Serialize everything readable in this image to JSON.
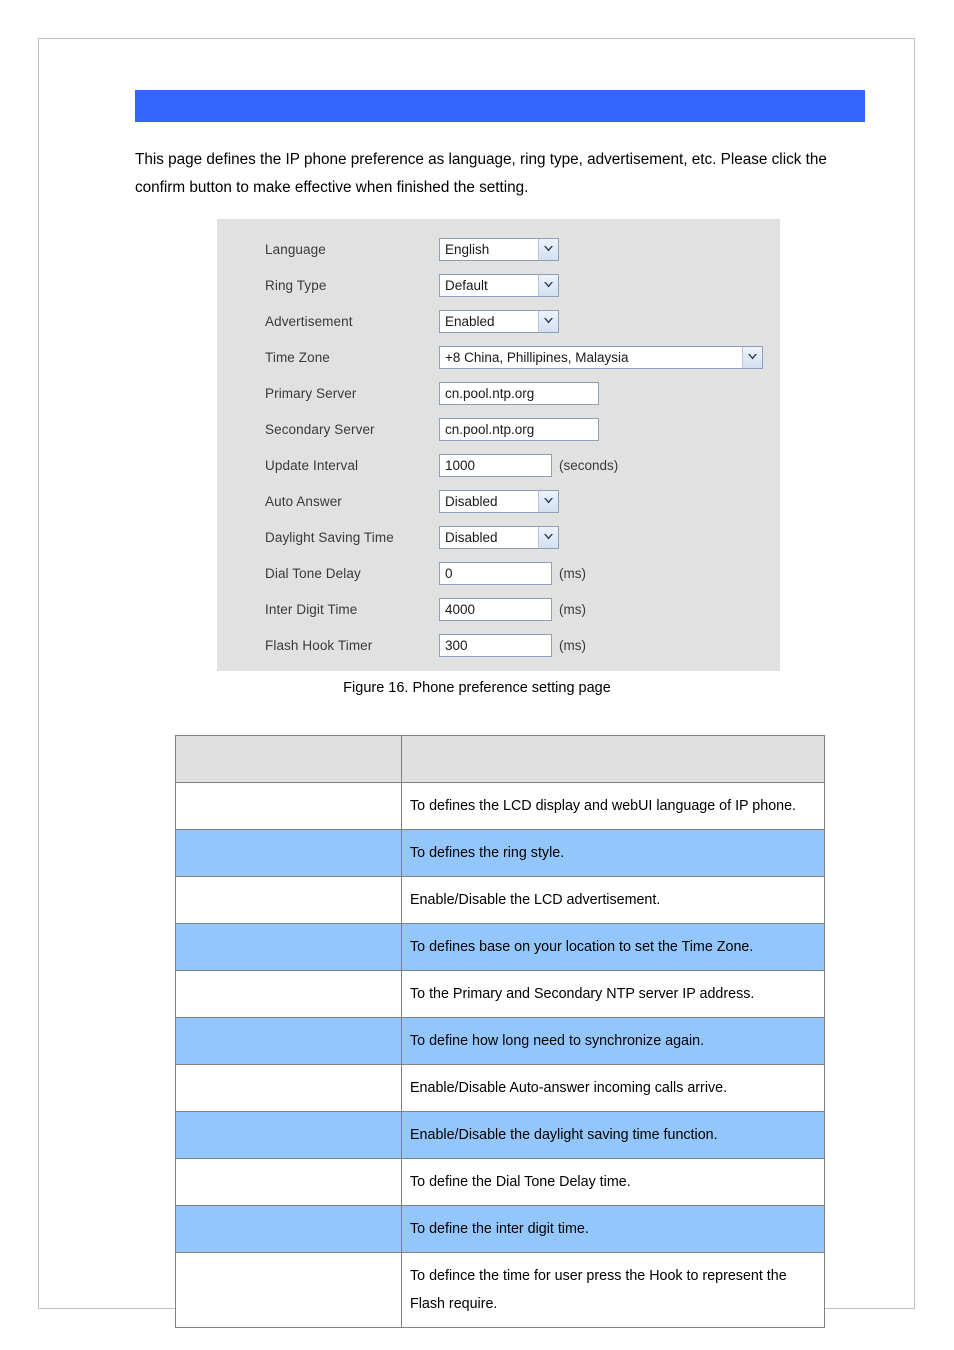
{
  "document": {
    "banner_title": "",
    "intro_paragraph": "This page defines the IP phone preference as language, ring type, advertisement, etc. Please click the confirm button to make effective when finished the setting.",
    "figure_caption": "Figure 16. Phone preference setting page"
  },
  "colors": {
    "banner_blue": "#3366ff",
    "table_row_blue": "#93c6fb",
    "table_header_gray": "#e0e0e0",
    "panel_gray": "#e1e1e1",
    "page_border": "#bfbfbf"
  },
  "form": {
    "rows": [
      {
        "label": "Language",
        "control": "select",
        "value": "English",
        "unit": ""
      },
      {
        "label": "Ring Type",
        "control": "select",
        "value": "Default",
        "unit": ""
      },
      {
        "label": "Advertisement",
        "control": "select",
        "value": "Enabled",
        "unit": ""
      },
      {
        "label": "Time Zone",
        "control": "select-wide",
        "value": "+8  China, Phillipines, Malaysia",
        "unit": ""
      },
      {
        "label": "Primary Server",
        "control": "text",
        "value": "cn.pool.ntp.org",
        "unit": ""
      },
      {
        "label": "Secondary Server",
        "control": "text",
        "value": "cn.pool.ntp.org",
        "unit": ""
      },
      {
        "label": "Update Interval",
        "control": "number",
        "value": "1000",
        "unit": "(seconds)"
      },
      {
        "label": "Auto Answer",
        "control": "select",
        "value": "Disabled",
        "unit": ""
      },
      {
        "label": "Daylight Saving Time",
        "control": "select",
        "value": "Disabled",
        "unit": ""
      },
      {
        "label": "Dial Tone Delay",
        "control": "number",
        "value": "0",
        "unit": "(ms)"
      },
      {
        "label": "Inter Digit Time",
        "control": "number",
        "value": "4000",
        "unit": "(ms)"
      },
      {
        "label": "Flash Hook Timer",
        "control": "number",
        "value": "300",
        "unit": "(ms)"
      }
    ]
  },
  "table": {
    "headers": [
      "",
      ""
    ],
    "rows": [
      {
        "name": "",
        "description": "To defines the LCD display and webUI language of IP phone."
      },
      {
        "name": "",
        "description": "To defines the ring style."
      },
      {
        "name": "",
        "description": "Enable/Disable the LCD advertisement."
      },
      {
        "name": "",
        "description": "To defines base on your location to set the Time Zone."
      },
      {
        "name": "",
        "description": "To the Primary and Secondary NTP server IP address."
      },
      {
        "name": "",
        "description": "To define how long need to synchronize again."
      },
      {
        "name": "",
        "description": "Enable/Disable Auto-answer incoming calls arrive."
      },
      {
        "name": "",
        "description": "Enable/Disable the daylight saving time function."
      },
      {
        "name": "",
        "description": "To define the Dial Tone Delay time."
      },
      {
        "name": "",
        "description": "To define the inter digit time."
      },
      {
        "name": "",
        "description": "To defince the time for user press the Hook to represent the Flash require."
      }
    ]
  }
}
